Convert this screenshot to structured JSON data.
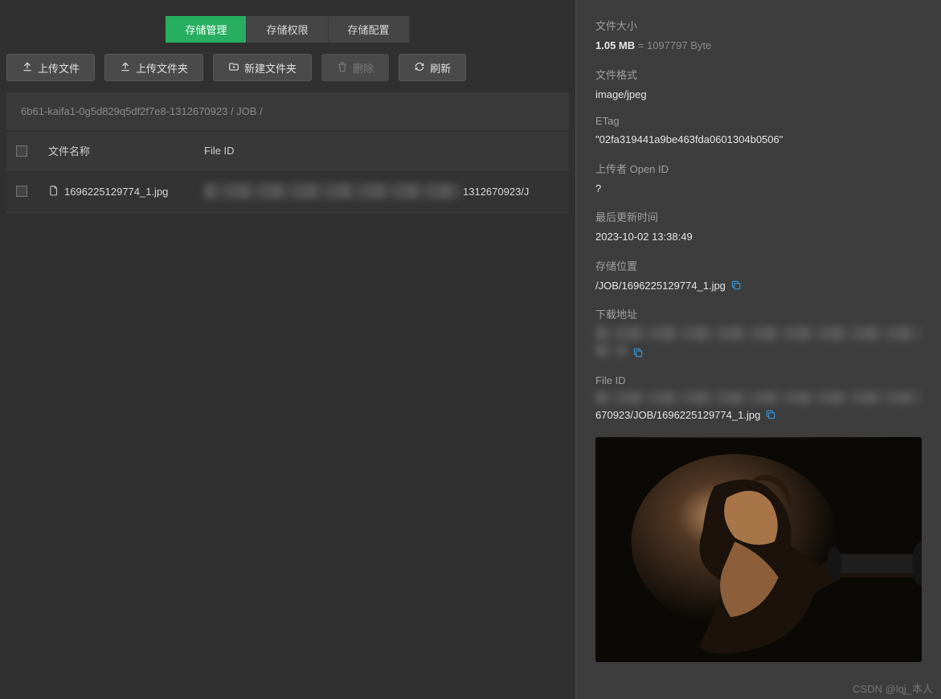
{
  "tabs": {
    "storage_manage": "存储管理",
    "storage_perm": "存储权限",
    "storage_config": "存储配置"
  },
  "toolbar": {
    "upload_file": "上传文件",
    "upload_folder": "上传文件夹",
    "new_folder": "新建文件夹",
    "delete": "删除",
    "refresh": "刷新"
  },
  "breadcrumb": "6b61-kaifa1-0g5d829q5df2f7e8-1312670923 / JOB /",
  "table": {
    "col_name": "文件名称",
    "col_file_id": "File ID",
    "rows": [
      {
        "name": "1696225129774_1.jpg",
        "ext": "1312670923/J"
      }
    ]
  },
  "detail": {
    "size_label": "文件大小",
    "size_value": "1.05 MB",
    "size_bytes": "= 1097797 Byte",
    "format_label": "文件格式",
    "format_value": "image/jpeg",
    "etag_label": "ETag",
    "etag_value": "\"02fa319441a9be463fda0601304b0506\"",
    "uploader_label": "上传者 Open ID",
    "uploader_value": "?",
    "updated_label": "最后更新时间",
    "updated_value": "2023-10-02 13:38:49",
    "location_label": "存储位置",
    "location_value": "/JOB/1696225129774_1.jpg",
    "download_label": "下载地址",
    "fileid_label": "File ID",
    "fileid_suffix": "670923/JOB/1696225129774_1.jpg"
  },
  "watermark": "CSDN @lqj_本人"
}
